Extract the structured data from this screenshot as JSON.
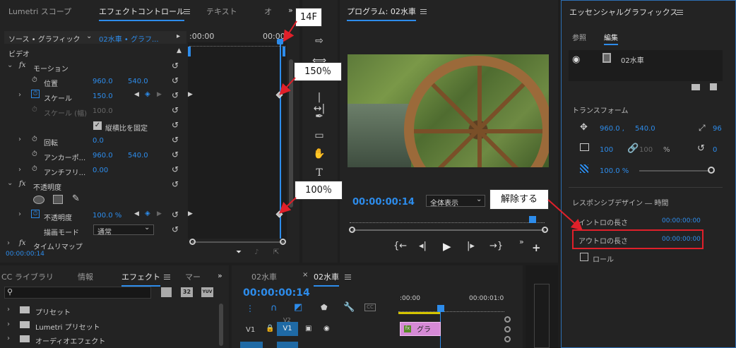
{
  "left_panel": {
    "tabs": [
      "Lumetri スコープ",
      "エフェクトコントロール",
      "テキスト",
      "オ"
    ],
    "source_label": "ソース • グラフィック",
    "sequence_label": "02水車 • グラフ...",
    "timecode_start": ":00:00",
    "timecode_end": "00:00",
    "video_header": "ビデオ",
    "motion": "モーション",
    "position_label": "位置",
    "position_x": "960.0",
    "position_y": "540.0",
    "scale_label": "スケール",
    "scale_value": "150.0",
    "scale_width_label": "スケール (幅)",
    "scale_width_value": "100.0",
    "uniform_scale": "縦横比を固定",
    "rotation_label": "回転",
    "rotation_value": "0.0",
    "anchor_label": "アンカーポ...",
    "anchor_x": "960.0",
    "anchor_y": "540.0",
    "antiflicker_label": "アンチフリ...",
    "antiflicker_value": "0.00",
    "opacity_section": "不透明度",
    "opacity_label": "不透明度",
    "opacity_value": "100.0 %",
    "blend_label": "描画モード",
    "blend_value": "通常",
    "timeremap_label": "タイムリマップ",
    "footer_timecode": "00:00:00:14"
  },
  "callouts": {
    "frame": "14F",
    "scale": "150％",
    "opacity": "100％",
    "release": "解除する"
  },
  "program": {
    "title": "プログラム: 02水車",
    "timecode": "00:00:00:14",
    "zoom": "全体表示"
  },
  "essential": {
    "title": "エッセンシャルグラフィックス",
    "tab_browse": "参照",
    "tab_edit": "編集",
    "layer_name": "02水車",
    "transform_header": "トランスフォーム",
    "pos_x": "960.0 ,",
    "pos_y": "540.0",
    "pos_right": "96",
    "scale": "100",
    "scale2": "100",
    "percent": "%",
    "rotation": "0",
    "opacity": "100.0 %",
    "responsive_header": "レスポンシブデザイン ― 時間",
    "intro_label": "イントロの長さ",
    "intro_value": "00:00:00:00",
    "outro_label": "アウトロの長さ",
    "outro_value": "00:00:00:00",
    "roll_label": "ロール"
  },
  "effects_panel": {
    "tabs": [
      "CC ライブラリ",
      "情報",
      "エフェクト",
      "マー"
    ],
    "items": [
      "プリセット",
      "Lumetri プリセット",
      "オーディオエフェクト"
    ],
    "icon_labels": [
      "32",
      "YUV"
    ]
  },
  "timeline": {
    "tab1": "02水車",
    "tab2": "02水車",
    "timecode": "00:00:00:14",
    "ruler_start": ":00:00",
    "ruler_end": "00:00:01:0",
    "track_v1": "V1",
    "track_v1_target": "V1",
    "track_v2": "V2",
    "clip_label": "グラ"
  },
  "colors": {
    "accent": "#2d8ceb",
    "highlight_box": "#e0202a",
    "clip": "#d68ad6"
  }
}
